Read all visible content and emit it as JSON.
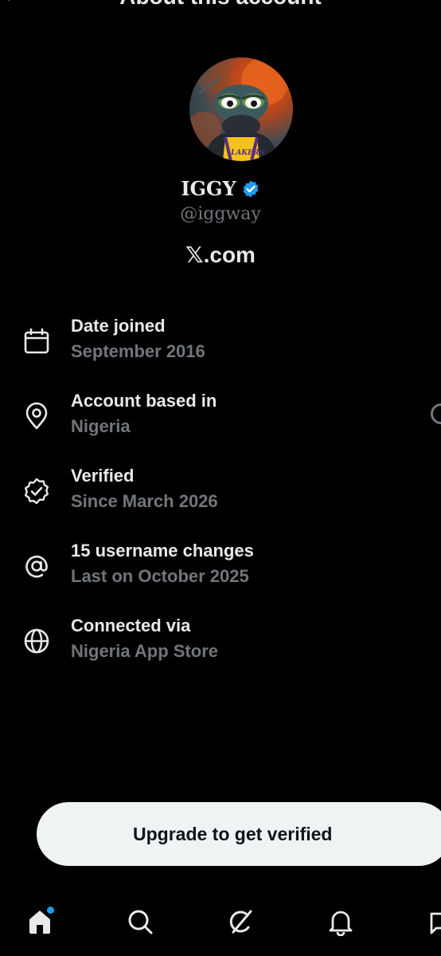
{
  "header": {
    "title": "About this account",
    "back_icon": "back-arrow-icon"
  },
  "profile": {
    "name": "IGGY",
    "handle": "@iggway",
    "platform": "𝕏.com",
    "verified_color": "#1d9bf0"
  },
  "details": [
    {
      "icon": "calendar-icon",
      "label": "Date joined",
      "value": "September 2016"
    },
    {
      "icon": "location-pin-icon",
      "label": "Account based in",
      "value": "Nigeria"
    },
    {
      "icon": "verified-check-icon",
      "label": "Verified",
      "value": "Since March 2026"
    },
    {
      "icon": "at-sign-icon",
      "label": "15 username changes",
      "value": "Last on October 2025"
    },
    {
      "icon": "globe-icon",
      "label": "Connected via",
      "value": "Nigeria App Store"
    }
  ],
  "upgrade": {
    "label": "Upgrade to get verified"
  },
  "nav": {
    "items": [
      "home-icon",
      "search-icon",
      "grok-icon",
      "notifications-icon",
      "messages-icon"
    ],
    "accent": "#1d9bf0"
  },
  "colors": {
    "background": "#000000",
    "primary_text": "#e7e9ea",
    "secondary_text": "#71767b",
    "button_bg": "#eff3f4"
  }
}
